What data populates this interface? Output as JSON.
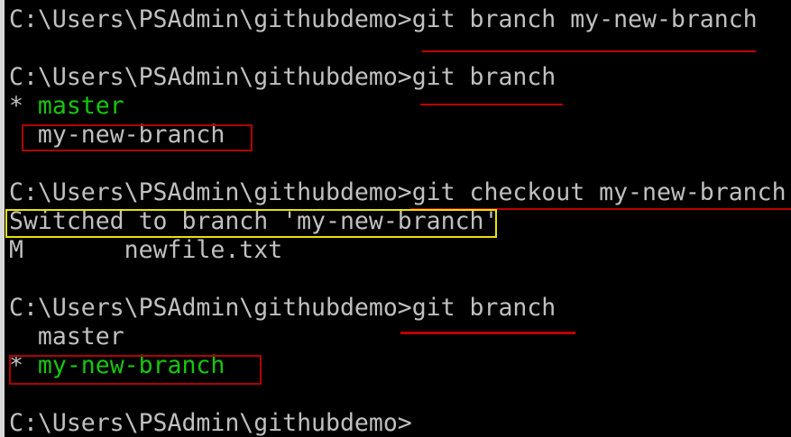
{
  "terminal": {
    "lines": {
      "l1": "C:\\Users\\PSAdmin\\githubdemo>git branch my-new-branch",
      "l2": "C:\\Users\\PSAdmin\\githubdemo>git branch",
      "l3_star": "* ",
      "l3_branch": "master",
      "l4_branch": "my-new-branch",
      "l5": "C:\\Users\\PSAdmin\\githubdemo>git checkout my-new-branch",
      "l6": "Switched to branch 'my-new-branch'",
      "l7_status": "M",
      "l7_file": "newfile.txt",
      "l8": "C:\\Users\\PSAdmin\\githubdemo>git branch",
      "l9_branch": "master",
      "l10_star": "* ",
      "l10_branch": "my-new-branch",
      "l11": "C:\\Users\\PSAdmin\\githubdemo>"
    }
  },
  "colors": {
    "background": "#000000",
    "text": "#c0c0c0",
    "current_branch": "#16c60c",
    "annotation_red": "#c00000",
    "annotation_yellow": "#e8e400"
  }
}
